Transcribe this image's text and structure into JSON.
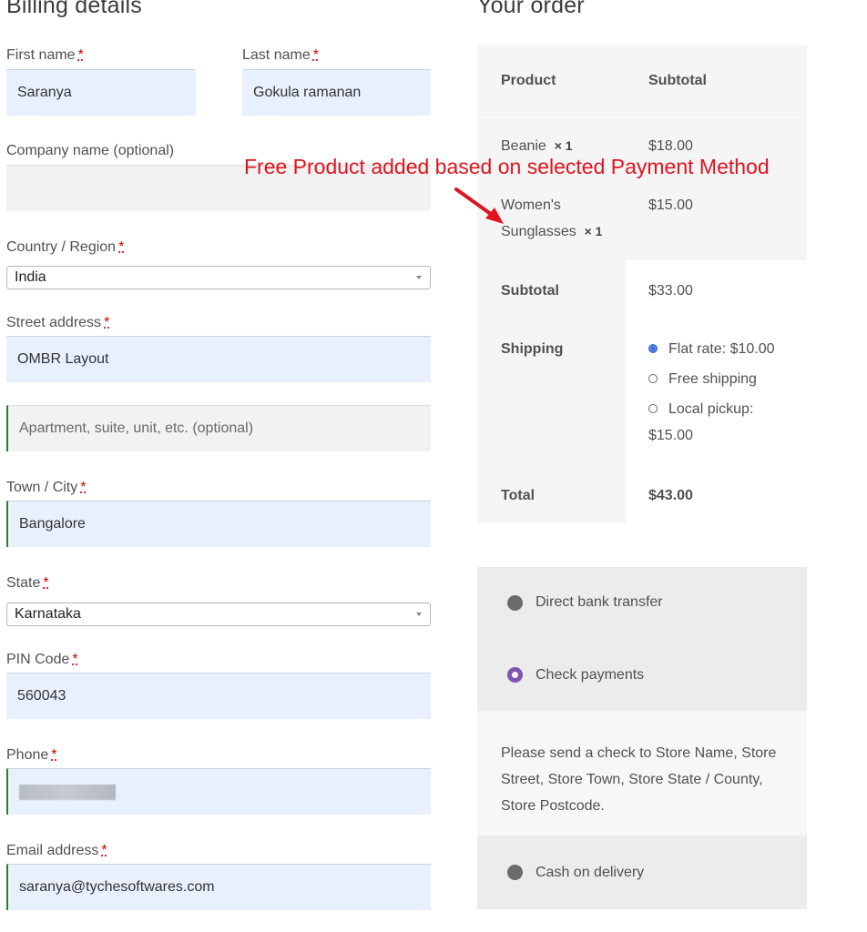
{
  "billing": {
    "title": "Billing details",
    "required_mark": "*",
    "first_name": {
      "label": "First name",
      "value": "Saranya"
    },
    "last_name": {
      "label": "Last name",
      "value": "Gokula ramanan"
    },
    "company": {
      "label": "Company name (optional)",
      "value": ""
    },
    "country": {
      "label": "Country / Region",
      "value": "India"
    },
    "street": {
      "label": "Street address",
      "value": "OMBR Layout",
      "placeholder2": "Apartment, suite, unit, etc. (optional)"
    },
    "city": {
      "label": "Town / City",
      "value": "Bangalore"
    },
    "state": {
      "label": "State",
      "value": "Karnataka"
    },
    "pin": {
      "label": "PIN Code",
      "value": "560043"
    },
    "phone": {
      "label": "Phone",
      "value": ""
    },
    "email": {
      "label": "Email address",
      "value": "saranya@tychesoftwares.com"
    }
  },
  "order": {
    "title": "Your order",
    "col_product": "Product",
    "col_subtotal": "Subtotal",
    "items": [
      {
        "name": "Beanie",
        "qty": "× 1",
        "price": "$18.00"
      },
      {
        "name": "Women's",
        "name2": "Sunglasses",
        "qty": "× 1",
        "price": "$15.00"
      }
    ],
    "subtotal_label": "Subtotal",
    "subtotal_value": "$33.00",
    "shipping_label": "Shipping",
    "shipping_options": [
      {
        "label": "Flat rate: $10.00",
        "selected": true
      },
      {
        "label": "Free shipping",
        "selected": false
      },
      {
        "label": "Local pickup:",
        "label2": "$15.00",
        "selected": false
      }
    ],
    "total_label": "Total",
    "total_value": "$43.00"
  },
  "payment": {
    "methods": [
      {
        "label": "Direct bank transfer",
        "selected": false
      },
      {
        "label": "Check payments",
        "selected": true
      },
      {
        "label": "Cash on delivery",
        "selected": false
      }
    ],
    "description_lines": [
      "Please send a check to Store Name, Store",
      "Street, Store Town, Store State / County,",
      "Store Postcode."
    ]
  },
  "annotation": {
    "text": "Free Product added based on selected Payment Method",
    "color": "#e0141e"
  }
}
